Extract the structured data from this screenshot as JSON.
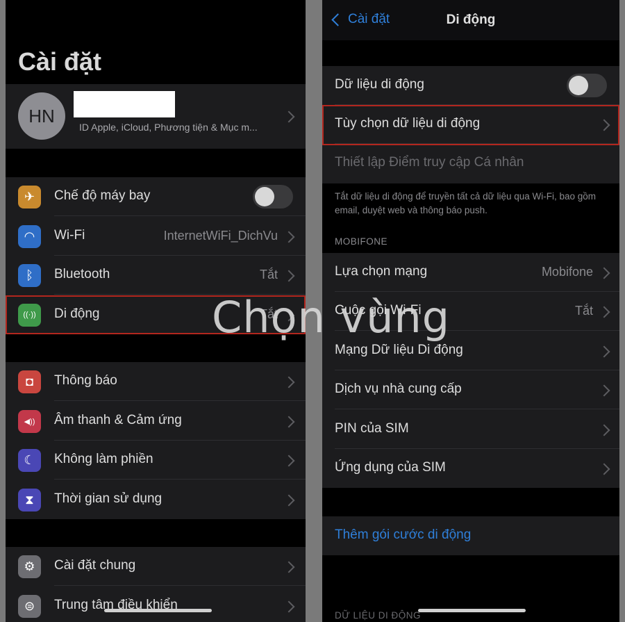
{
  "left": {
    "title": "Cài đặt",
    "profile": {
      "initials": "HN",
      "subtitle": "ID Apple, iCloud, Phương tiện & Mục m..."
    },
    "items": [
      {
        "label": "Chế độ máy bay",
        "value": "",
        "icon": "airplane-icon",
        "icon_color": "#c98a2e",
        "glyph": "✈",
        "control": "toggle"
      },
      {
        "label": "Wi-Fi",
        "value": "InternetWiFi_DichVu",
        "icon": "wifi-icon",
        "icon_color": "#2f6ec7",
        "glyph": "◠",
        "control": "chevron"
      },
      {
        "label": "Bluetooth",
        "value": "Tắt",
        "icon": "bluetooth-icon",
        "icon_color": "#2f6ec7",
        "glyph": "ᛒ",
        "control": "chevron"
      },
      {
        "label": "Di động",
        "value": "Tắt",
        "icon": "cellular-icon",
        "icon_color": "#3f9a4a",
        "glyph": "((·))",
        "control": "chevron"
      },
      {
        "label": "Thông báo",
        "value": "",
        "icon": "notifications-icon",
        "icon_color": "#c9463f",
        "glyph": "◘",
        "control": "chevron"
      },
      {
        "label": "Âm thanh & Cảm ứng",
        "value": "",
        "icon": "sound-icon",
        "icon_color": "#c2384a",
        "glyph": "◀))",
        "control": "chevron"
      },
      {
        "label": "Không làm phiền",
        "value": "",
        "icon": "moon-icon",
        "icon_color": "#4a47b5",
        "glyph": "☾",
        "control": "chevron"
      },
      {
        "label": "Thời gian sử dụng",
        "value": "",
        "icon": "hourglass-icon",
        "icon_color": "#4a47b5",
        "glyph": "⧗",
        "control": "chevron"
      },
      {
        "label": "Cài đặt chung",
        "value": "",
        "icon": "gear-icon",
        "icon_color": "#6d6d72",
        "glyph": "⚙",
        "control": "chevron"
      },
      {
        "label": "Trung tâm điều khiển",
        "value": "",
        "icon": "control-center-icon",
        "icon_color": "#6d6d72",
        "glyph": "⊜",
        "control": "chevron"
      }
    ]
  },
  "right": {
    "back_label": "Cài đặt",
    "title": "Di động",
    "cellular_data_label": "Dữ liệu di động",
    "cellular_options_label": "Tùy chọn dữ liệu di động",
    "hotspot_label": "Thiết lập Điểm truy cập Cá nhân",
    "footer_note": "Tắt dữ liệu di động để truyền tất cả dữ liệu qua Wi-Fi, bao gồm email, duyệt web và thông báo push.",
    "carrier_header": "MOBIFONE",
    "carrier_items": [
      {
        "label": "Lựa chọn mạng",
        "value": "Mobifone"
      },
      {
        "label": "Cuộc gọi Wi-Fi",
        "value": "Tắt"
      },
      {
        "label": "Mạng Dữ liệu Di động",
        "value": ""
      },
      {
        "label": "Dịch vụ nhà cung cấp",
        "value": ""
      },
      {
        "label": "PIN của SIM",
        "value": ""
      },
      {
        "label": "Ứng dụng của SIM",
        "value": ""
      }
    ],
    "add_plan_label": "Thêm gói cước di động",
    "bottom_header": "DỮ LIỆU DI ĐỘNG"
  },
  "overlay_text": "Chọn vùng",
  "colors": {
    "link": "#2f7fd9",
    "highlight": "#b3261e",
    "background": "#000000",
    "cell": "#1c1c1e"
  }
}
